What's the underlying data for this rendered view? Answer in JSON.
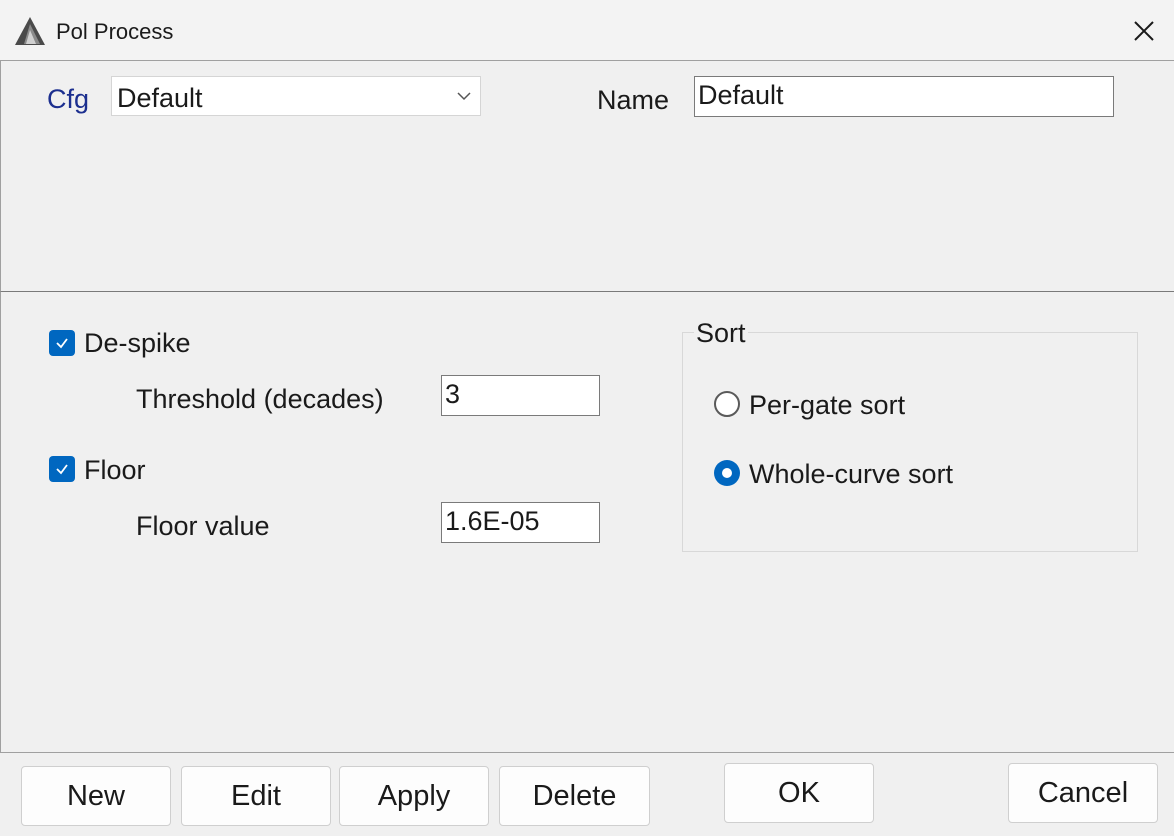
{
  "window": {
    "title": "Pol Process"
  },
  "config": {
    "cfg_label": "Cfg",
    "cfg_value": "Default",
    "name_label": "Name",
    "name_value": "Default"
  },
  "despike": {
    "label": "De-spike",
    "checked": true,
    "threshold_label": "Threshold (decades)",
    "threshold_value": "3"
  },
  "floor": {
    "label": "Floor",
    "checked": true,
    "value_label": "Floor value",
    "value": "1.6E-05"
  },
  "sort": {
    "title": "Sort",
    "options": [
      {
        "label": "Per-gate sort",
        "selected": false
      },
      {
        "label": "Whole-curve sort",
        "selected": true
      }
    ]
  },
  "buttons": {
    "new": "New",
    "edit": "Edit",
    "apply": "Apply",
    "delete": "Delete",
    "ok": "OK",
    "cancel": "Cancel"
  },
  "colors": {
    "accent": "#0067c0",
    "cfg_label": "#1c2f8f",
    "background": "#f0f0f0"
  }
}
